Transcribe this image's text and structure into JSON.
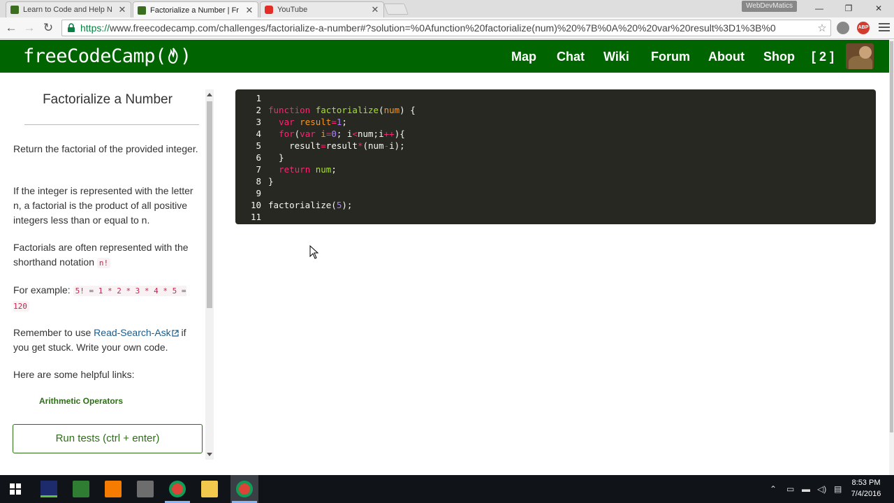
{
  "browser": {
    "tabs": [
      {
        "label": "Learn to Code and Help N",
        "active": false,
        "favicon": "fcc-icon"
      },
      {
        "label": "Factorialize a Number | Fr",
        "active": true,
        "favicon": "fcc-icon"
      },
      {
        "label": "YouTube",
        "active": false,
        "favicon": "youtube-icon"
      }
    ],
    "profile_label": "WebDevMatics",
    "url_protocol": "https://",
    "url_rest": "www.freecodecamp.com/challenges/factorialize-a-number#?solution=%0Afunction%20factorialize(num)%20%7B%0A%20%20var%20result%3D1%3B%0",
    "abp_label": "ABP"
  },
  "site": {
    "logo": "freeCodeCamp(🔥)",
    "logo_text": "freeCodeCamp(",
    "logo_close": ")",
    "nav": [
      "Map",
      "Chat",
      "Wiki",
      "Forum",
      "About",
      "Shop",
      "[ 2 ]"
    ],
    "brand_color": "#006400"
  },
  "challenge": {
    "title": "Factorialize a Number",
    "p1": "Return the factorial of the provided integer.",
    "p2": "If the integer is represented with the letter n, a factorial is the product of all positive integers less than or equal to n.",
    "p3_text": "Factorials are often represented with the shorthand notation ",
    "p3_code": "n!",
    "p4_text": "For example: ",
    "p4_code": "5! = 1 * 2 * 3 * 4 * 5 = 120",
    "p5_before": "Remember to use ",
    "p5_link": "Read-Search-Ask",
    "p5_after": " if you get stuck. Write your own code.",
    "p6": "Here are some helpful links:",
    "helpful_link": "Arithmetic Operators",
    "run_button": "Run tests (ctrl + enter)"
  },
  "editor": {
    "line_numbers": [
      "1",
      "2",
      "3",
      "4",
      "5",
      "6",
      "7",
      "8",
      "9",
      "10",
      "11"
    ],
    "lines": [
      "",
      "function factorialize(num) {",
      "  var result=1;",
      "  for(var i=0; i<num;i++){",
      "    result=result*(num-i);",
      "  }",
      "  return num;",
      "}",
      "",
      "factorialize(5);",
      ""
    ]
  },
  "taskbar": {
    "time": "8:53 PM",
    "date": "7/4/2016"
  }
}
